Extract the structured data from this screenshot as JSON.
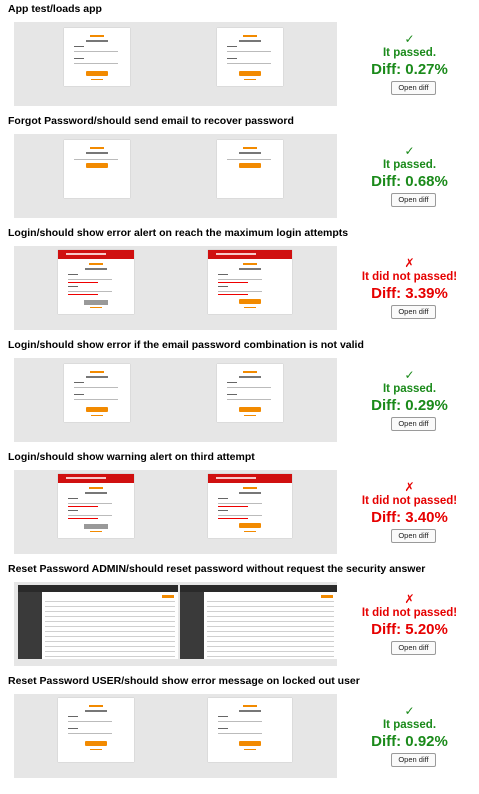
{
  "tests": [
    {
      "title": "App test/loads app",
      "mark": "✓",
      "status": "It passed.",
      "diff": "Diff: 0.27%",
      "passed": true,
      "kind": "login"
    },
    {
      "title": "Forgot Password/should send email to recover password",
      "mark": "✓",
      "status": "It passed.",
      "diff": "Diff: 0.68%",
      "passed": true,
      "kind": "forgot"
    },
    {
      "title": "Login/should show error alert on reach the maximum login attempts",
      "mark": "✗",
      "status": "It did not passed!",
      "diff": "Diff: 3.39%",
      "passed": false,
      "kind": "alert"
    },
    {
      "title": "Login/should show error if the email password combination is not valid",
      "mark": "✓",
      "status": "It passed.",
      "diff": "Diff: 0.29%",
      "passed": true,
      "kind": "login"
    },
    {
      "title": "Login/should show warning alert on third attempt",
      "mark": "✗",
      "status": "It did not passed!",
      "diff": "Diff: 3.40%",
      "passed": false,
      "kind": "alert"
    },
    {
      "title": "Reset Password ADMIN/should reset password without request the security answer",
      "mark": "✗",
      "status": "It did not passed!",
      "diff": "Diff: 5.20%",
      "passed": false,
      "kind": "admin"
    },
    {
      "title": "Reset Password USER/should show error message on locked out user",
      "mark": "✓",
      "status": "It passed.",
      "diff": "Diff: 0.92%",
      "passed": true,
      "kind": "reset"
    }
  ],
  "open_diff_label": "Open diff",
  "colors": {
    "pass": "#1a8a1a",
    "fail": "#e60000",
    "accent": "#f28a00",
    "alert": "#d01010"
  }
}
